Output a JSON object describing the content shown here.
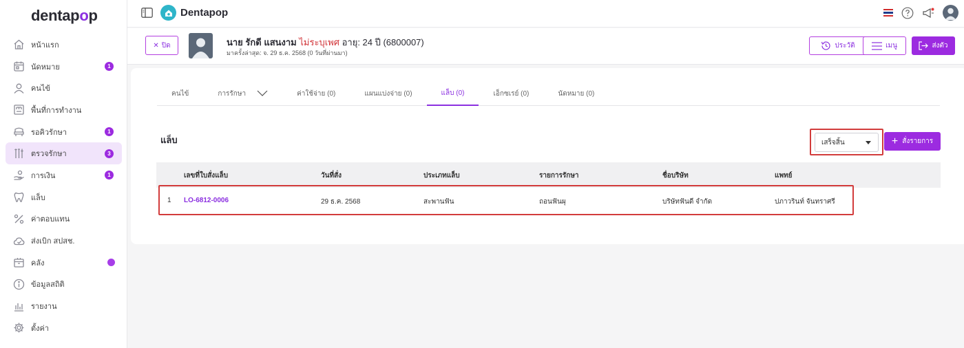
{
  "brand": {
    "logo_text_a": "dentap",
    "logo_text_o": "o",
    "logo_text_b": "p"
  },
  "sidebar": {
    "items": [
      {
        "icon": "home-icon",
        "label": "หน้าแรก"
      },
      {
        "icon": "calendar-icon",
        "label": "นัดหมาย",
        "badge": "1"
      },
      {
        "icon": "person-icon",
        "label": "คนไข้"
      },
      {
        "icon": "workspace-icon",
        "label": "พื้นที่การทำงาน"
      },
      {
        "icon": "waiting-chair-icon",
        "label": "รอคิวรักษา",
        "badge": "1"
      },
      {
        "icon": "dental-tools-icon",
        "label": "ตรวจรักษา",
        "badge": "3",
        "active": true
      },
      {
        "icon": "payment-icon",
        "label": "การเงิน",
        "badge": "1"
      },
      {
        "icon": "tooth-icon",
        "label": "แล็บ"
      },
      {
        "icon": "percent-icon",
        "label": "ค่าตอบแทน"
      },
      {
        "icon": "cloud-icon",
        "label": "ส่งเบิก สปสช."
      },
      {
        "icon": "inventory-icon",
        "label": "คลัง",
        "dot": true
      },
      {
        "icon": "info-icon",
        "label": "ข้อมูลสถิติ"
      },
      {
        "icon": "report-icon",
        "label": "รายงาน"
      },
      {
        "icon": "gear-icon",
        "label": "ตั้งค่า"
      }
    ]
  },
  "topbar": {
    "app_name": "Dentapop"
  },
  "patient": {
    "close_label": "ปิด",
    "name": "นาย รักดี แสนงาม",
    "gender": "ไม่ระบุเพศ",
    "age_id": "อายุ: 24 ปี  (6800007)",
    "last_visit": "มาครั้งล่าสุด: จ. 29 ธ.ค. 2568 (0 วันที่ผ่านมา)",
    "history_label": "ประวัติ",
    "menu_label": "เมนู",
    "send_label": "ส่งตัว"
  },
  "tabs": [
    {
      "label": "คนไข้"
    },
    {
      "label": "การรักษา",
      "dropdown": true
    },
    {
      "label": "ค่าใช้จ่าย (0)"
    },
    {
      "label": "แผนแบ่งจ่าย (0)"
    },
    {
      "label": "แล็บ (0)",
      "active": true
    },
    {
      "label": "เอ็กซเรย์ (0)"
    },
    {
      "label": "นัดหมาย (0)"
    }
  ],
  "lab": {
    "title": "แล็บ",
    "status_value": "เสร็จสิ้น",
    "order_label": "สั่งรายการ",
    "columns": [
      "เลขที่ใบสั่งแล็บ",
      "วันที่สั่ง",
      "ประเภทแล็บ",
      "รายการรักษา",
      "ชื่อบริษัท",
      "แพทย์"
    ],
    "rows": [
      {
        "index": "1",
        "order_no": "LO-6812-0006",
        "date": "29 ธ.ค. 2568",
        "lab_type": "สะพานฟัน",
        "treatment": "ถอนฟันผุ",
        "company": "บริษัทฟันดี จำกัด",
        "doctor": "ปภาวรินท์ จันทราศรี"
      }
    ]
  },
  "colors": {
    "accent": "#9c2be0",
    "highlight": "#d23b3b"
  }
}
